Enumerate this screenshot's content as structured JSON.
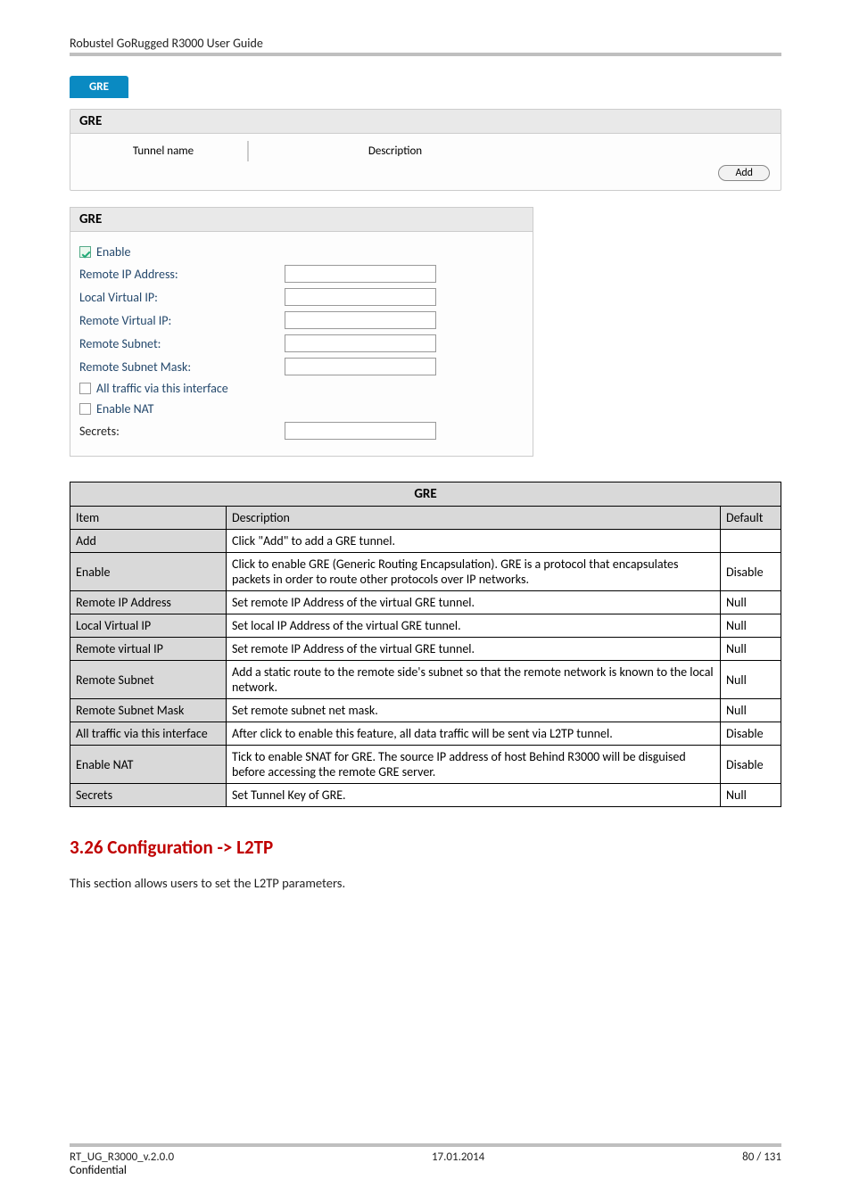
{
  "header": {
    "title": "Robustel GoRugged R3000 User Guide"
  },
  "tabs": {
    "gre": "GRE"
  },
  "block1": {
    "heading": "GRE",
    "col_tunnel": "Tunnel name",
    "col_desc": "Description",
    "add_btn": "Add"
  },
  "block2": {
    "heading": "GRE",
    "enable": "Enable",
    "remote_ip": "Remote IP Address:",
    "local_vip": "Local Virtual IP:",
    "remote_vip": "Remote Virtual IP:",
    "remote_subnet": "Remote Subnet:",
    "remote_mask": "Remote Subnet Mask:",
    "all_traffic": "All traffic via this interface",
    "enable_nat": "Enable NAT",
    "secrets": "Secrets:"
  },
  "table": {
    "title": "GRE",
    "col_item": "Item",
    "col_desc": "Description",
    "col_default": "Default",
    "rows": [
      {
        "item": "Add",
        "desc": "Click \"Add\" to add a GRE tunnel.",
        "def": ""
      },
      {
        "item": "Enable",
        "desc": "Click to enable GRE (Generic Routing Encapsulation). GRE is a protocol that encapsulates packets in order to route other protocols over IP networks.",
        "def": "Disable"
      },
      {
        "item": "Remote IP Address",
        "desc": "Set remote IP Address of the virtual GRE tunnel.",
        "def": "Null"
      },
      {
        "item": "Local Virtual IP",
        "desc": "Set local IP Address of the virtual GRE tunnel.",
        "def": "Null"
      },
      {
        "item": "Remote virtual IP",
        "desc": "Set remote IP Address of the virtual GRE tunnel.",
        "def": "Null"
      },
      {
        "item": "Remote Subnet",
        "desc": "Add a static route to the remote side's subnet so that the remote network is known to the local network.",
        "def": "Null"
      },
      {
        "item": "Remote Subnet Mask",
        "desc": "Set remote subnet net mask.",
        "def": "Null"
      },
      {
        "item": "All traffic via this interface",
        "desc": "After click to enable this feature, all data traffic will be sent via L2TP tunnel.",
        "def": "Disable"
      },
      {
        "item": "Enable NAT",
        "desc": "Tick to enable SNAT for GRE. The source IP address of host Behind R3000 will be disguised before accessing the remote GRE server.",
        "def": "Disable"
      },
      {
        "item": "Secrets",
        "desc": "Set Tunnel Key of GRE.",
        "def": "Null"
      }
    ]
  },
  "section": {
    "heading": "3.26  Configuration -> L2TP",
    "body": "This section allows users to set the L2TP parameters."
  },
  "footer": {
    "left": "RT_UG_R3000_v.2.0.0",
    "center": "17.01.2014",
    "right": "80 / 131",
    "conf": "Confidential"
  }
}
